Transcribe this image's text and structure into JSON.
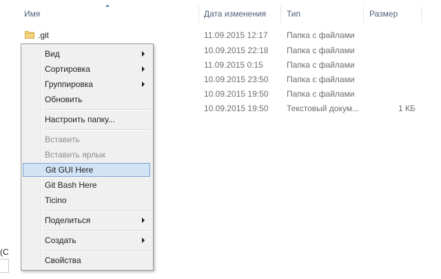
{
  "columns": {
    "name": "Имя",
    "date": "Дата изменения",
    "type": "Тип",
    "size": "Размер"
  },
  "files": [
    {
      "name": ".git",
      "date": "11.09.2015 12:17",
      "type": "Папка с файлами",
      "size": "",
      "icon": "folder-icon"
    },
    {
      "name": "",
      "date": "10.09.2015 22:18",
      "type": "Папка с файлами",
      "size": ""
    },
    {
      "name": "",
      "date": "11.09.2015 0:15",
      "type": "Папка с файлами",
      "size": ""
    },
    {
      "name": "",
      "date": "10.09.2015 23:50",
      "type": "Папка с файлами",
      "size": ""
    },
    {
      "name": "",
      "date": "10.09.2015 19:50",
      "type": "Папка с файлами",
      "size": ""
    },
    {
      "name": "",
      "date": "10.09.2015 19:50",
      "type": "Текстовый докум...",
      "size": "1 КБ"
    }
  ],
  "left_pane_clip": "(C",
  "context_menu": {
    "view": "Вид",
    "sort": "Сортировка",
    "group": "Группировка",
    "refresh": "Обновить",
    "customize": "Настроить папку...",
    "paste": "Вставить",
    "paste_shortcut": "Вставить ярлык",
    "git_gui": "Git GUI Here",
    "git_bash": "Git Bash Here",
    "ticino": "Ticino",
    "share": "Поделиться",
    "create": "Создать",
    "properties": "Свойства"
  },
  "colors": {
    "header_text": "#4c607a",
    "highlight_bg": "#d2e3f5",
    "highlight_border": "#7aa5d6",
    "menu_bg": "#f0f0f0"
  }
}
